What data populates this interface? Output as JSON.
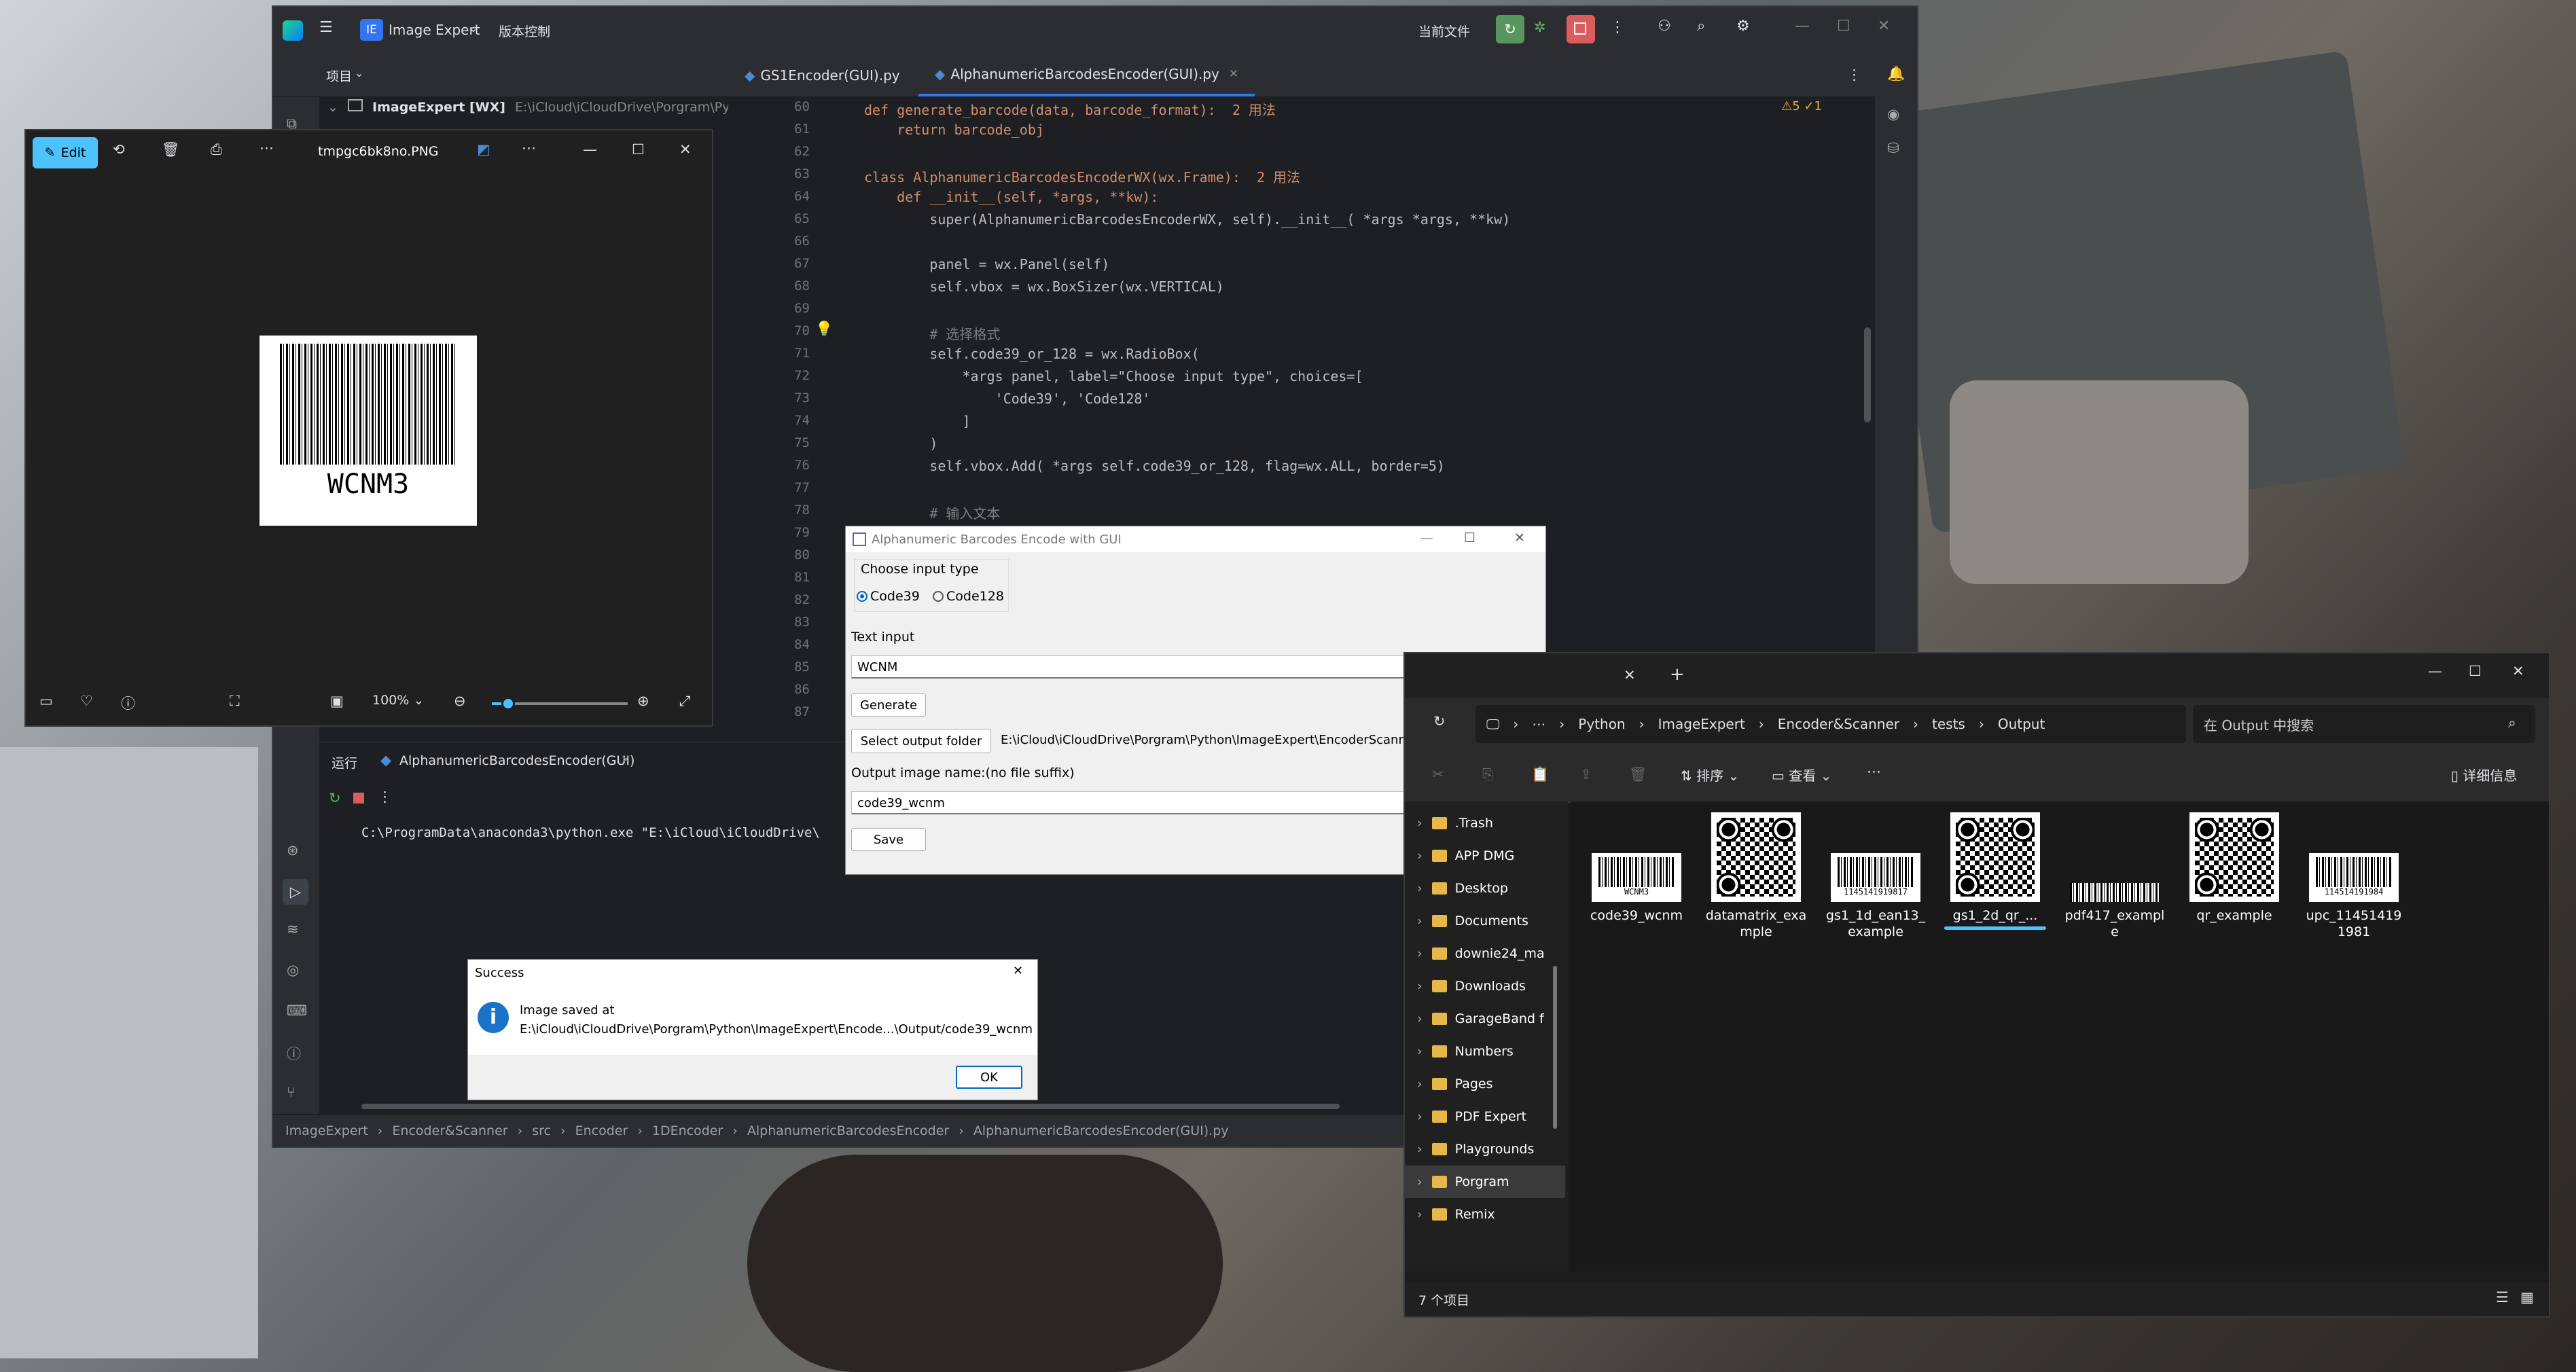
{
  "ide": {
    "app_badge": "IE",
    "project_name": "Image Expert",
    "vcs": "版本控制",
    "current_file": "当前文件",
    "project_label": "项目",
    "tree_root": "ImageExpert [WX]",
    "tree_root_path": "E:\\iCloud\\iCloudDrive\\Porgram\\Python\\Im",
    "tabs": [
      "GS1Encoder(GUI).py",
      "AlphanumericBarcodesEncoder(GUI).py"
    ],
    "inspection": "⚠5 ✓1",
    "code_lines": [
      {
        "n": "60",
        "t": "def generate_barcode(data, barcode_format):  2 用法"
      },
      {
        "n": "61",
        "t": "    return barcode_obj"
      },
      {
        "n": "62",
        "t": ""
      },
      {
        "n": "63",
        "t": "class AlphanumericBarcodesEncoderWX(wx.Frame):  2 用法"
      },
      {
        "n": "64",
        "t": "    def __init__(self, *args, **kw):"
      },
      {
        "n": "65",
        "t": "        super(AlphanumericBarcodesEncoderWX, self).__init__( *args *args, **kw)"
      },
      {
        "n": "66",
        "t": ""
      },
      {
        "n": "67",
        "t": "        panel = wx.Panel(self)"
      },
      {
        "n": "68",
        "t": "        self.vbox = wx.BoxSizer(wx.VERTICAL)"
      },
      {
        "n": "69",
        "t": ""
      },
      {
        "n": "70",
        "t": "        # 选择格式"
      },
      {
        "n": "71",
        "t": "        self.code39_or_128 = wx.RadioBox("
      },
      {
        "n": "72",
        "t": "            *args panel, label=\"Choose input type\", choices=["
      },
      {
        "n": "73",
        "t": "                'Code39', 'Code128'"
      },
      {
        "n": "74",
        "t": "            ]"
      },
      {
        "n": "75",
        "t": "        )"
      },
      {
        "n": "76",
        "t": "        self.vbox.Add( *args self.code39_or_128, flag=wx.ALL, border=5)"
      },
      {
        "n": "77",
        "t": ""
      },
      {
        "n": "78",
        "t": "        # 输入文本"
      },
      {
        "n": "79",
        "t": ""
      },
      {
        "n": "80",
        "t": ""
      },
      {
        "n": "81",
        "t": ""
      },
      {
        "n": "82",
        "t": ""
      },
      {
        "n": "83",
        "t": ""
      },
      {
        "n": "84",
        "t": ""
      },
      {
        "n": "85",
        "t": ""
      },
      {
        "n": "86",
        "t": ""
      },
      {
        "n": "87",
        "t": ""
      }
    ],
    "run_label": "运行",
    "run_tab": "AlphanumericBarcodesEncoder(GUI)",
    "run_output": "C:\\ProgramData\\anaconda3\\python.exe \"E:\\iCloud\\iCloudDrive\\",
    "breadcrumb": [
      "ImageExpert",
      "Encoder&Scanner",
      "src",
      "Encoder",
      "1DEncoder",
      "AlphanumericBarcodesEncoder",
      "AlphanumericBarcodesEncoder(GUI).py"
    ]
  },
  "photos": {
    "edit_label": "Edit",
    "filename": "tmpgc6bk8no.PNG",
    "barcode_text": "WCNM3",
    "zoom": "100%",
    "zoom_level": 0.12
  },
  "wx": {
    "title": "Alphanumeric Barcodes Encode with GUI",
    "radio_group_label": "Choose input type",
    "radio_options": [
      "Code39",
      "Code128"
    ],
    "radio_selected": "Code39",
    "text_input_label": "Text input",
    "text_input_value": "WCNM",
    "generate_label": "Generate",
    "select_folder_label": "Select output folder",
    "output_folder": "E:\\iCloud\\iCloudDrive\\Porgram\\Python\\ImageExpert\\EncoderScanner\\tests\\Output",
    "output_name_label": "Output image name:(no file suffix)",
    "output_name_value": "code39_wcnm",
    "save_label": "Save"
  },
  "success": {
    "title": "Success",
    "line1": "Image saved at",
    "line2": "E:\\iCloud\\iCloudDrive\\Porgram\\Python\\ImageExpert\\Encode...\\Output/code39_wcnm",
    "ok_label": "OK"
  },
  "explorer": {
    "path": [
      "Python",
      "ImageExpert",
      "Encoder&Scanner",
      "tests",
      "Output"
    ],
    "search_placeholder": "在 Output 中搜索",
    "sort_label": "排序",
    "view_label": "查看",
    "details_label": "详细信息",
    "nav_items": [
      ".Trash",
      "APP DMG",
      "Desktop",
      "Documents",
      "downie24_ma",
      "Downloads",
      "GarageBand f",
      "Numbers",
      "Pages",
      "PDF Expert",
      "Playgrounds",
      "Porgram",
      "Remix"
    ],
    "selected_nav": "Porgram",
    "files": [
      {
        "name": "code39_wcnm",
        "kind": "barcode",
        "caption": "WCNM3"
      },
      {
        "name": "datamatrix_example",
        "kind": "qr",
        "caption": ""
      },
      {
        "name": "gs1_1d_ean13_example",
        "kind": "barcode",
        "caption": "1145141919817"
      },
      {
        "name": "gs1_2d_qr_...",
        "kind": "qr",
        "caption": ""
      },
      {
        "name": "pdf417_example",
        "kind": "pdf417",
        "caption": ""
      },
      {
        "name": "qr_example",
        "kind": "qr",
        "caption": ""
      },
      {
        "name": "upc_114514191981",
        "kind": "barcode",
        "caption": "114514191984"
      }
    ],
    "status": "7 个项目"
  }
}
